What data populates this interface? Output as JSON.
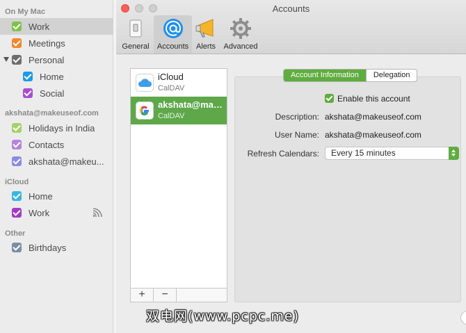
{
  "sidebar": {
    "sections": [
      {
        "heading": "On My Mac"
      },
      {
        "heading": "akshata@makeuseof.com"
      },
      {
        "heading": "iCloud"
      },
      {
        "heading": "Other"
      }
    ],
    "calendars": [
      {
        "label": "Work",
        "color": "#7fc24a",
        "selected": true
      },
      {
        "label": "Meetings",
        "color": "#f0892e"
      },
      {
        "label": "Personal",
        "color": "#6e6e6e"
      },
      {
        "label": "Home",
        "color": "#1e9ae6"
      },
      {
        "label": "Social",
        "color": "#a84ed1"
      },
      {
        "label": "Holidays in India",
        "color": "#a7d06c"
      },
      {
        "label": "Contacts",
        "color": "#b584db"
      },
      {
        "label": "akshata@makeu...",
        "color": "#8f8be0"
      },
      {
        "label": "Home",
        "color": "#37b6de"
      },
      {
        "label": "Work",
        "color": "#a13dc4"
      },
      {
        "label": "Birthdays",
        "color": "#7b8ea5"
      }
    ]
  },
  "window": {
    "title": "Accounts",
    "toolbar": [
      {
        "label": "General",
        "icon": "switch-icon"
      },
      {
        "label": "Accounts",
        "icon": "at-sign-icon",
        "active": true
      },
      {
        "label": "Alerts",
        "icon": "megaphone-icon"
      },
      {
        "label": "Advanced",
        "icon": "gear-icon"
      }
    ],
    "accounts": [
      {
        "name": "iCloud",
        "type": "CalDAV",
        "icon": "icloud-icon"
      },
      {
        "name": "akshata@mak...",
        "type": "CalDAV",
        "icon": "google-icon",
        "selected": true
      }
    ],
    "list_buttons": {
      "add": "+",
      "remove": "−"
    },
    "tabs": {
      "account_information": "Account Information",
      "delegation": "Delegation"
    },
    "form": {
      "enable_label": "Enable this account",
      "description_label": "Description:",
      "description_value": "akshata@makeuseof.com",
      "username_label": "User Name:",
      "username_value": "akshata@makeuseof.com",
      "refresh_label": "Refresh Calendars:",
      "refresh_value": "Every 15 minutes"
    }
  },
  "watermark": "双电网(www.pcpc.me)",
  "colors": {
    "accent_green": "#5fac3f",
    "selection_green": "#5ea84a"
  }
}
